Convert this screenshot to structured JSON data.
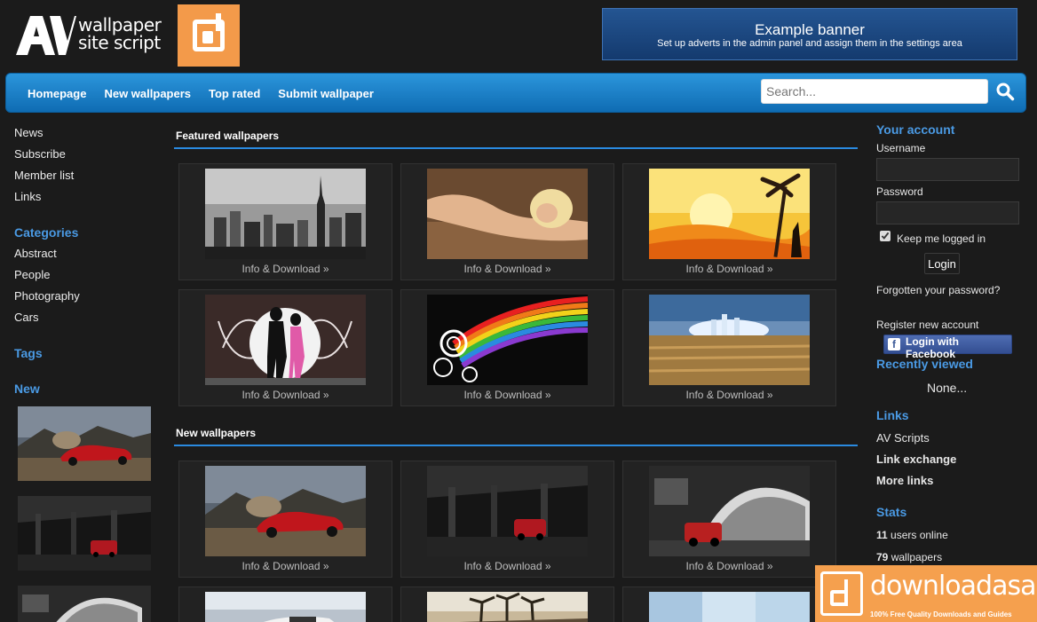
{
  "header": {
    "logo_text_line1": "wallpaper",
    "logo_text_line2": "site script",
    "banner_title": "Example banner",
    "banner_subtitle": "Set up adverts in the admin panel and assign them in the settings area"
  },
  "nav": {
    "items": [
      "Homepage",
      "New wallpapers",
      "Top rated",
      "Submit wallpaper"
    ],
    "search_placeholder": "Search..."
  },
  "left_sidebar": {
    "links": [
      "News",
      "Subscribe",
      "Member list",
      "Links"
    ],
    "categories_heading": "Categories",
    "categories": [
      "Abstract",
      "People",
      "Photography",
      "Cars"
    ],
    "tags_heading": "Tags",
    "new_heading": "New"
  },
  "main": {
    "featured_heading": "Featured wallpapers",
    "new_heading": "New wallpapers",
    "download_label": "Info & Download »"
  },
  "right_sidebar": {
    "account_heading": "Your account",
    "username_label": "Username",
    "password_label": "Password",
    "keep_logged_label": "Keep me logged in",
    "login_label": "Login",
    "forgot_label": "Forgotten your password?",
    "register_label": "Register new account",
    "facebook_label": "Login with Facebook",
    "recently_heading": "Recently viewed",
    "recently_value": "None...",
    "links_heading": "Links",
    "links": [
      "AV Scripts",
      "Link exchange",
      "More links"
    ],
    "stats_heading": "Stats",
    "stats_online_count": "11",
    "stats_online_label": "users online",
    "stats_wallpapers_count": "79",
    "stats_wallpapers_label": "wallpapers"
  },
  "watermark": {
    "name": "downloadasap",
    "tagline": "100% Free Quality Downloads and Guides"
  },
  "colors": {
    "accent": "#2a8ae0",
    "heading_blue": "#4a9ae4",
    "background": "#1b1b1b",
    "watermark_orange": "#f5a04e"
  }
}
